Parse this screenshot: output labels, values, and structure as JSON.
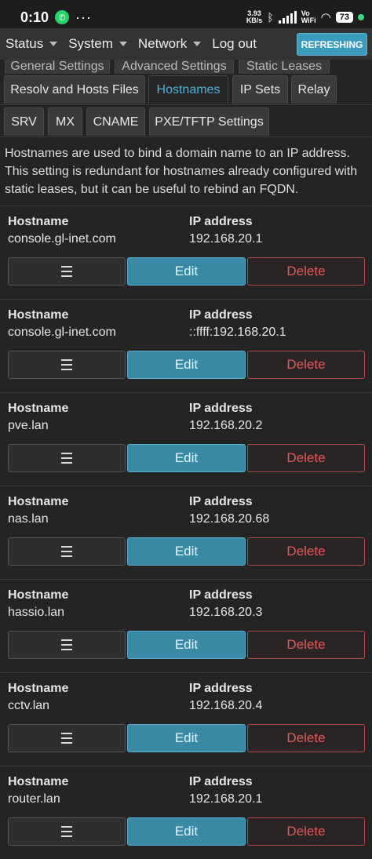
{
  "statusbar": {
    "time": "0:10",
    "speed_value": "3.93",
    "speed_unit": "KB/s",
    "vowifi_top": "Vo",
    "vowifi_bottom": "WiFi",
    "battery": "73"
  },
  "nav": {
    "items": [
      {
        "label": "Status"
      },
      {
        "label": "System"
      },
      {
        "label": "Network"
      },
      {
        "label": "Log out"
      }
    ],
    "refresh_label": "REFRESHING"
  },
  "tabs": {
    "row0": [
      "General Settings",
      "Advanced Settings",
      "Static Leases"
    ],
    "row1": [
      "Resolv and Hosts Files",
      "Hostnames",
      "IP Sets",
      "Relay"
    ],
    "row2": [
      "SRV",
      "MX",
      "CNAME",
      "PXE/TFTP Settings"
    ],
    "active": "Hostnames"
  },
  "description": "Hostnames are used to bind a domain name to an IP address. This setting is redundant for hostnames already configured with static leases, but it can be useful to rebind an FQDN.",
  "labels": {
    "hostname": "Hostname",
    "ip": "IP address",
    "edit": "Edit",
    "delete": "Delete"
  },
  "entries": [
    {
      "hostname": "console.gl-inet.com",
      "ip": "192.168.20.1"
    },
    {
      "hostname": "console.gl-inet.com",
      "ip": "::ffff:192.168.20.1"
    },
    {
      "hostname": "pve.lan",
      "ip": "192.168.20.2"
    },
    {
      "hostname": "nas.lan",
      "ip": "192.168.20.68"
    },
    {
      "hostname": "hassio.lan",
      "ip": "192.168.20.3"
    },
    {
      "hostname": "cctv.lan",
      "ip": "192.168.20.4"
    },
    {
      "hostname": "router.lan",
      "ip": "192.168.20.1"
    }
  ]
}
